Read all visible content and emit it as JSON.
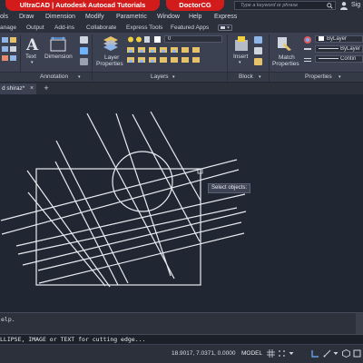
{
  "title_bar": {
    "brand_pill": "UltraCAD | Autodesk Autocad Tutorials",
    "channel_pill": "DoctorCG",
    "search_placeholder": "Type a keyword or phrase",
    "user_label": "Sig"
  },
  "menu": [
    "ols",
    "Draw",
    "Dimension",
    "Modify",
    "Parametric",
    "Window",
    "Help",
    "Express"
  ],
  "ribbon_tabs": [
    "anage",
    "Output",
    "Add-ins",
    "Collaborate",
    "Express Tools",
    "Featured Apps"
  ],
  "ribbon": {
    "text_label": "Text",
    "dimension_label": "Dimension",
    "layer_properties_label": [
      "Layer",
      "Properties"
    ],
    "layer_dropdown_value": "0",
    "insert_label": "Insert",
    "match_properties_label": [
      "Match",
      "Properties"
    ],
    "bylayer_color": "ByLayer",
    "bylayer_linetype": "ByLayer",
    "continuous_label": "Contin",
    "panels": {
      "annotation": "Annotation",
      "layers": "Layers",
      "block": "Block",
      "properties": "Properties"
    }
  },
  "document_tab": {
    "name": "d shiraz*",
    "close_symbol": "×",
    "add_symbol": "+"
  },
  "canvas": {
    "tooltip": "Select objects:"
  },
  "command_history": "elp.",
  "command_line": "LLIPSE, IMAGE or TEXT for cutting edge...",
  "status_bar": {
    "coordinates": "18.9017, 7.0371, 0.0000",
    "model": "MODEL"
  },
  "colors": {
    "title_pill": "#d21c1c",
    "canvas_bg": "#212732",
    "geometry": "#ffffff"
  }
}
